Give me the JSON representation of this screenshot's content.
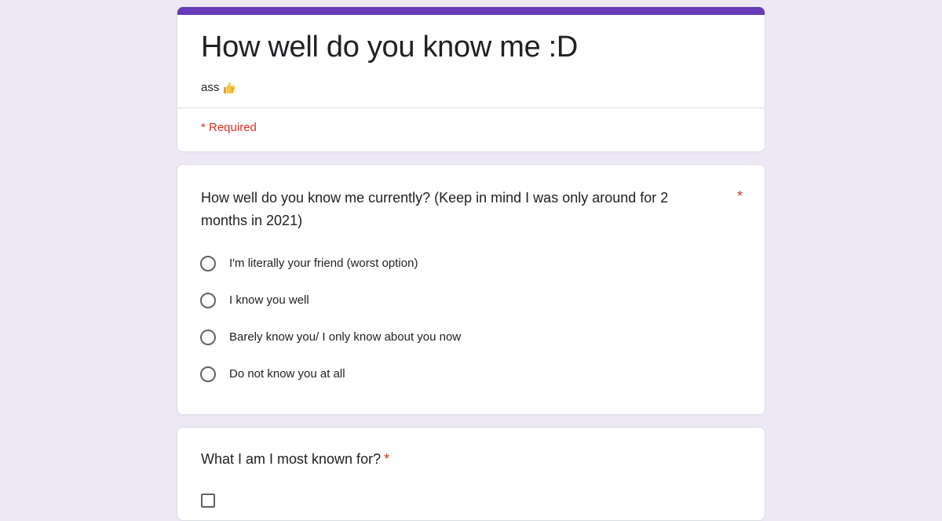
{
  "form": {
    "title": "How well do you know me :D",
    "description": "ass",
    "description_emoji": "thumbs-up-icon",
    "required_note": "* Required",
    "accent_color": "#673ab7",
    "background_color": "#ede7f6",
    "required_color": "#d93025"
  },
  "questions": [
    {
      "title": "How well do you know me currently? (Keep in mind I was only around for 2 months in 2021)",
      "required_mark": "*",
      "type": "radio",
      "options": [
        "I'm literally your friend (worst option)",
        "I know you well",
        "Barely know you/ I only know about you now",
        "Do not know you at all"
      ]
    },
    {
      "title": "What I am I most known for?",
      "required_mark": "*",
      "type": "checkbox"
    }
  ]
}
